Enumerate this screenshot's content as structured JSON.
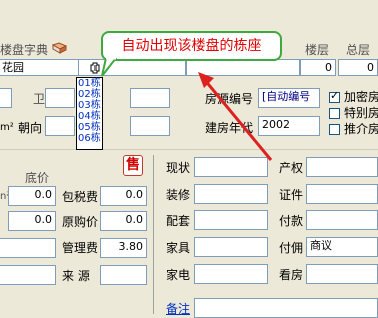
{
  "colors": {
    "callout_text": "#e00000",
    "callout_border": "#3fa83f",
    "arrow": "#dd2020",
    "sell": "#d10000",
    "dropdown_text": "#0030c0"
  },
  "header": {
    "dictionary_label": "楼盘字典",
    "floor_label": "楼层",
    "total_floors_label": "总层",
    "estate_value": "花园",
    "floor_value": "0",
    "total_floors_value": "0"
  },
  "callout": {
    "text": "自动出现该楼盘的栋座"
  },
  "dropdown": {
    "items": [
      "01栋",
      "02栋",
      "03栋",
      "04栋",
      "05栋",
      "06栋"
    ]
  },
  "row1": {
    "wei_label": "卫",
    "house_no_label": "房源编号",
    "house_no_value": "[自动编号",
    "encrypt_label": "加密房"
  },
  "row2": {
    "orientation_label": "朝向",
    "build_year_label": "建房年代",
    "build_year_value": "2002",
    "special_label": "特别房",
    "recommend_label": "推介房"
  },
  "mid": {
    "sell_icon": "售",
    "base_price_label": "底价"
  },
  "form_left": {
    "tax_label": "包税费",
    "tax_value": "0.0",
    "orig_price_label": "原购价",
    "orig_price_value": "0.0",
    "mgmt_fee_label": "管理费",
    "mgmt_fee_value": "3.80",
    "source_label": "来  源",
    "left_value1": "0.0",
    "left_value2": "0.0"
  },
  "form_mid": {
    "status_label": "现状",
    "decor_label": "装修",
    "facility_label": "配套",
    "furniture_label": "家具",
    "appliance_label": "家电",
    "remark_label": "备注"
  },
  "form_right": {
    "property_label": "产权",
    "cert_label": "证件",
    "pay_label": "付款",
    "commission_label": "付佣",
    "commission_value": "商议",
    "viewing_label": "看房"
  },
  "left_edge": {
    "sq1": "m²",
    "sq2": "n²"
  }
}
